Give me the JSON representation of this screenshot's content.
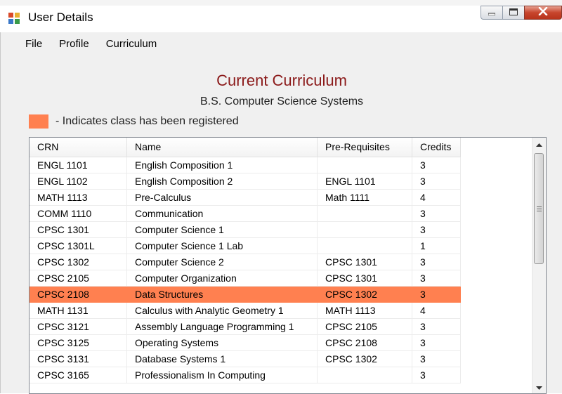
{
  "window": {
    "title": "User Details"
  },
  "menu": {
    "items": [
      "File",
      "Profile",
      "Curriculum"
    ]
  },
  "curriculum": {
    "heading": "Current Curriculum",
    "program": "B.S. Computer Science Systems",
    "legend_text": "- Indicates class has been registered"
  },
  "colors": {
    "registered": "#ff8050",
    "heading": "#8b1a1a"
  },
  "table": {
    "columns": [
      "CRN",
      "Name",
      "Pre-Requisites",
      "Credits"
    ],
    "rows": [
      {
        "crn": "ENGL 1101",
        "name": "English Composition 1",
        "prereq": "",
        "credits": "3",
        "registered": false
      },
      {
        "crn": "ENGL 1102",
        "name": "English Composition 2",
        "prereq": "ENGL 1101",
        "credits": "3",
        "registered": false
      },
      {
        "crn": "MATH 1113",
        "name": "Pre-Calculus",
        "prereq": "Math 1111",
        "credits": "4",
        "registered": false
      },
      {
        "crn": "COMM 1110",
        "name": "Communication",
        "prereq": "",
        "credits": "3",
        "registered": false
      },
      {
        "crn": "CPSC 1301",
        "name": "Computer Science 1",
        "prereq": "",
        "credits": "3",
        "registered": false
      },
      {
        "crn": "CPSC 1301L",
        "name": "Computer Science 1 Lab",
        "prereq": "",
        "credits": "1",
        "registered": false
      },
      {
        "crn": "CPSC 1302",
        "name": "Computer Science 2",
        "prereq": "CPSC 1301",
        "credits": "3",
        "registered": false
      },
      {
        "crn": "CPSC 2105",
        "name": "Computer Organization",
        "prereq": "CPSC 1301",
        "credits": "3",
        "registered": false
      },
      {
        "crn": "CPSC 2108",
        "name": "Data Structures",
        "prereq": "CPSC 1302",
        "credits": "3",
        "registered": true
      },
      {
        "crn": "MATH 1131",
        "name": "Calculus with Analytic Geometry 1",
        "prereq": "MATH 1113",
        "credits": "4",
        "registered": false
      },
      {
        "crn": "CPSC 3121",
        "name": "Assembly Language Programming 1",
        "prereq": "CPSC 2105",
        "credits": "3",
        "registered": false
      },
      {
        "crn": "CPSC 3125",
        "name": "Operating Systems",
        "prereq": "CPSC 2108",
        "credits": "3",
        "registered": false
      },
      {
        "crn": "CPSC 3131",
        "name": "Database Systems 1",
        "prereq": "CPSC 1302",
        "credits": "3",
        "registered": false
      },
      {
        "crn": "CPSC 3165",
        "name": "Professionalism In Computing",
        "prereq": "",
        "credits": "3",
        "registered": false
      }
    ]
  },
  "icons": {
    "app": "app-window-icon",
    "minimize": "minimize-icon",
    "maximize": "maximize-icon",
    "close": "close-icon",
    "scroll_up": "scroll-up-icon",
    "scroll_down": "scroll-down-icon"
  }
}
